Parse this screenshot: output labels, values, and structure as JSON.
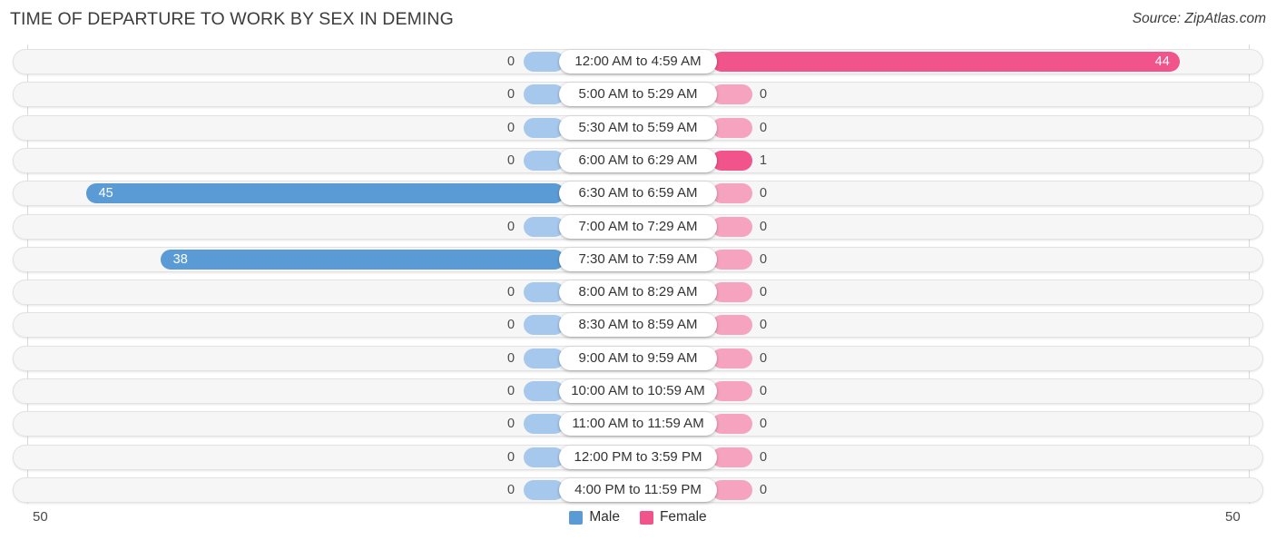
{
  "header": {
    "title": "TIME OF DEPARTURE TO WORK BY SEX IN DEMING",
    "source": "Source: ZipAtlas.com"
  },
  "axis": {
    "left_label": "50",
    "right_label": "50"
  },
  "legend": {
    "items": [
      {
        "label": "Male",
        "color": "#5b9bd5"
      },
      {
        "label": "Female",
        "color": "#f0548a"
      }
    ]
  },
  "chart_data": {
    "type": "bar",
    "title": "TIME OF DEPARTURE TO WORK BY SEX IN DEMING",
    "subtitle": "Source: ZipAtlas.com",
    "orientation": "horizontal-diverging",
    "xlabel": "",
    "ylabel": "",
    "xlim": [
      50,
      50
    ],
    "axis_left_max": 50,
    "axis_right_max": 50,
    "grid": true,
    "legend_position": "bottom-center",
    "categories": [
      "12:00 AM to 4:59 AM",
      "5:00 AM to 5:29 AM",
      "5:30 AM to 5:59 AM",
      "6:00 AM to 6:29 AM",
      "6:30 AM to 6:59 AM",
      "7:00 AM to 7:29 AM",
      "7:30 AM to 7:59 AM",
      "8:00 AM to 8:29 AM",
      "8:30 AM to 8:59 AM",
      "9:00 AM to 9:59 AM",
      "10:00 AM to 10:59 AM",
      "11:00 AM to 11:59 AM",
      "12:00 PM to 3:59 PM",
      "4:00 PM to 11:59 PM"
    ],
    "series": [
      {
        "name": "Male",
        "color": "#5b9bd5",
        "values": [
          0,
          0,
          0,
          0,
          45,
          0,
          38,
          0,
          0,
          0,
          0,
          0,
          0,
          0
        ]
      },
      {
        "name": "Female",
        "color": "#f0548a",
        "values": [
          44,
          0,
          0,
          1,
          0,
          0,
          0,
          0,
          0,
          0,
          0,
          0,
          0,
          0
        ]
      }
    ]
  }
}
